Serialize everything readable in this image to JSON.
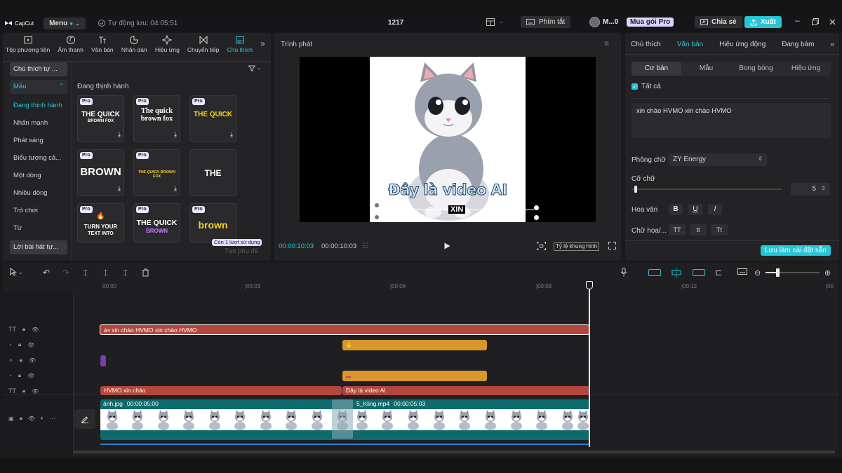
{
  "app": {
    "logo_text": "CapCut",
    "menu_label": "Menu",
    "autosave": "Tự động lưu: 04:05:51",
    "project_name": "1217",
    "shortcut_label": "Phím tắt",
    "user_name": "M...0",
    "pro_label": "Mua gói Pro",
    "share_label": "Chia sẻ",
    "export_label": "Xuất"
  },
  "toolbar": {
    "items": [
      {
        "label": "Tệp phương tiện",
        "icon": "media-icon"
      },
      {
        "label": "Âm thanh",
        "icon": "audio-icon"
      },
      {
        "label": "Văn bản",
        "icon": "text-icon"
      },
      {
        "label": "Nhãn dán",
        "icon": "sticker-icon"
      },
      {
        "label": "Hiệu ứng",
        "icon": "effects-icon"
      },
      {
        "label": "Chuyển tiếp",
        "icon": "transition-icon"
      },
      {
        "label": "Chú thích",
        "icon": "captions-icon"
      }
    ],
    "more": "»"
  },
  "sidebar": {
    "top_button": "Chú thích tự ...",
    "templates_label": "Mẫu",
    "items": [
      "Đang thịnh hành",
      "Nhấn mạnh",
      "Phát sáng",
      "Biểu tượng cả...",
      "Một dòng",
      "Nhiều dòng",
      "Trò chơi",
      "Từ"
    ],
    "bottom_button": "Lời bài hát tự..."
  },
  "templates": {
    "section_title": "Đang thịnh hành",
    "pro_badge": "Pro",
    "tiles": [
      {
        "text": "THE QUICK",
        "sub": "BROWN FOX"
      },
      {
        "text": "The quick brown fox",
        "sub": ""
      },
      {
        "text": "THE QUICK",
        "sub": ""
      },
      {
        "text": "BROWN",
        "sub": ""
      },
      {
        "text": "THE QUICK BROWN FOX",
        "sub": ""
      },
      {
        "text": "THE",
        "sub": ""
      },
      {
        "text": "TURN YOUR",
        "sub": "TEXT INTO"
      },
      {
        "text": "THE QUICK",
        "sub": "BROWN"
      },
      {
        "text": "brown",
        "sub": ""
      }
    ],
    "usage_badge": "Còn 1 lượt sử dụng",
    "create_caption": "Tạo phụ đề"
  },
  "player": {
    "title": "Trình phát",
    "overlay_text": "Đây là video AI",
    "overlay_small": "XIN",
    "time_current": "00:00:10:03",
    "time_total": "00:00:10:03",
    "ratio_label": "Tỷ lệ khung hình"
  },
  "inspector": {
    "tabs": [
      "Chú thích",
      "Văn bản",
      "Hiệu ứng động",
      "Đang bám"
    ],
    "active_tab": "Văn bản",
    "subtabs": [
      "Cơ bản",
      "Mẫu",
      "Bong bóng",
      "Hiệu ứng"
    ],
    "select_all": "Tất cả",
    "text_value": "xin chào HVMO  xin chào HVMO",
    "font_label": "Phông chữ",
    "font_value": "ZY Energy",
    "size_label": "Cỡ chữ",
    "size_value": "5",
    "size_fraction": 0.02,
    "pattern_label": "Hoa văn",
    "case_label": "Chữ hoa/...",
    "case_options": [
      "TT",
      "tt",
      "Tt"
    ],
    "save_preset": "Lưu làm cài đặt sẵn"
  },
  "timeline": {
    "ruler": [
      "00:00",
      "|00:03",
      "|00:06",
      "|00:09",
      "|00:12",
      "|00"
    ],
    "clips": {
      "caption_track": "xin chào HVMO  xin chào HVMO",
      "text_a": "HVMO xin chào",
      "text_b": "Đây là video AI",
      "video_a_name": "ảnh.jpg",
      "video_a_dur": "00:00:05:00",
      "video_b_name": "5_Kling.mp4",
      "video_b_dur": "00:00:05:03"
    }
  },
  "colors": {
    "accent": "#27c6d6",
    "caption_clip": "#b4473d",
    "audio_clip": "#d8962c",
    "effect_clip": "#7a3ea8",
    "video_track": "#0e6a6c"
  }
}
